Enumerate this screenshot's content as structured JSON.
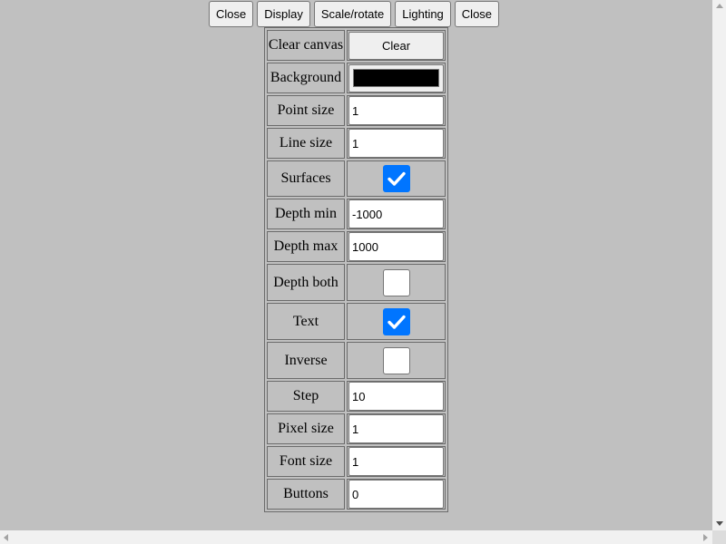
{
  "toolbar": {
    "buttons": [
      "Close",
      "Display",
      "Scale/rotate",
      "Lighting",
      "Close"
    ]
  },
  "colors": {
    "page_bg": "#c0c0c0",
    "checkbox_accent": "#0075ff",
    "background_swatch": "#000000"
  },
  "settings": {
    "clear_canvas": {
      "label": "Clear canvas",
      "button": "Clear"
    },
    "background": {
      "label": "Background",
      "color": "#000000"
    },
    "point_size": {
      "label": "Point size",
      "value": "1"
    },
    "line_size": {
      "label": "Line size",
      "value": "1"
    },
    "surfaces": {
      "label": "Surfaces",
      "checked": true
    },
    "depth_min": {
      "label": "Depth min",
      "value": "-1000"
    },
    "depth_max": {
      "label": "Depth max",
      "value": "1000"
    },
    "depth_both": {
      "label": "Depth both",
      "checked": false
    },
    "text": {
      "label": "Text",
      "checked": true
    },
    "inverse": {
      "label": "Inverse",
      "checked": false
    },
    "step": {
      "label": "Step",
      "value": "10"
    },
    "pixel_size": {
      "label": "Pixel size",
      "value": "1"
    },
    "font_size": {
      "label": "Font size",
      "value": "1"
    },
    "buttons": {
      "label": "Buttons",
      "value": "0"
    }
  },
  "icons": {
    "checkmark": "check-icon",
    "scroll_up": "triangle-up-icon",
    "scroll_down": "triangle-down-icon",
    "scroll_left": "triangle-left-icon",
    "scroll_right": "triangle-right-icon"
  }
}
